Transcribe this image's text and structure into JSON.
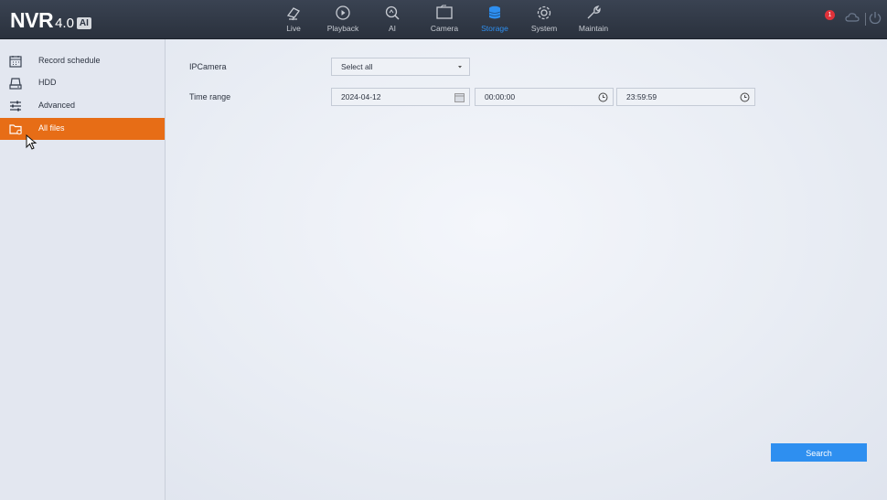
{
  "header": {
    "brand": "NVR",
    "version": "4.0",
    "badge": "AI",
    "nav": [
      {
        "label": "Live",
        "icon": "camera-icon"
      },
      {
        "label": "Playback",
        "icon": "playback-icon"
      },
      {
        "label": "AI",
        "icon": "ai-search-icon"
      },
      {
        "label": "Camera",
        "icon": "camera-screen-icon"
      },
      {
        "label": "Storage",
        "icon": "storage-icon"
      },
      {
        "label": "System",
        "icon": "gear-icon"
      },
      {
        "label": "Maintain",
        "icon": "wrench-icon"
      }
    ],
    "active_nav": "Storage",
    "alarm_count": "1"
  },
  "sidebar": {
    "items": [
      {
        "label": "Record schedule",
        "icon": "calendar-icon"
      },
      {
        "label": "HDD",
        "icon": "hdd-icon"
      },
      {
        "label": "Advanced",
        "icon": "sliders-icon"
      },
      {
        "label": "All files",
        "icon": "folder-icon"
      }
    ],
    "active_item": "All files"
  },
  "form": {
    "ipcamera_label": "IPCamera",
    "ipcamera_value": "Select all",
    "timerange_label": "Time range",
    "date_value": "2024-04-12",
    "start_time": "00:00:00",
    "end_time": "23:59:59",
    "search_label": "Search"
  },
  "colors": {
    "accent_blue": "#2e8ff0",
    "active_orange": "#e76d16",
    "header_bg": "#2f3746"
  }
}
